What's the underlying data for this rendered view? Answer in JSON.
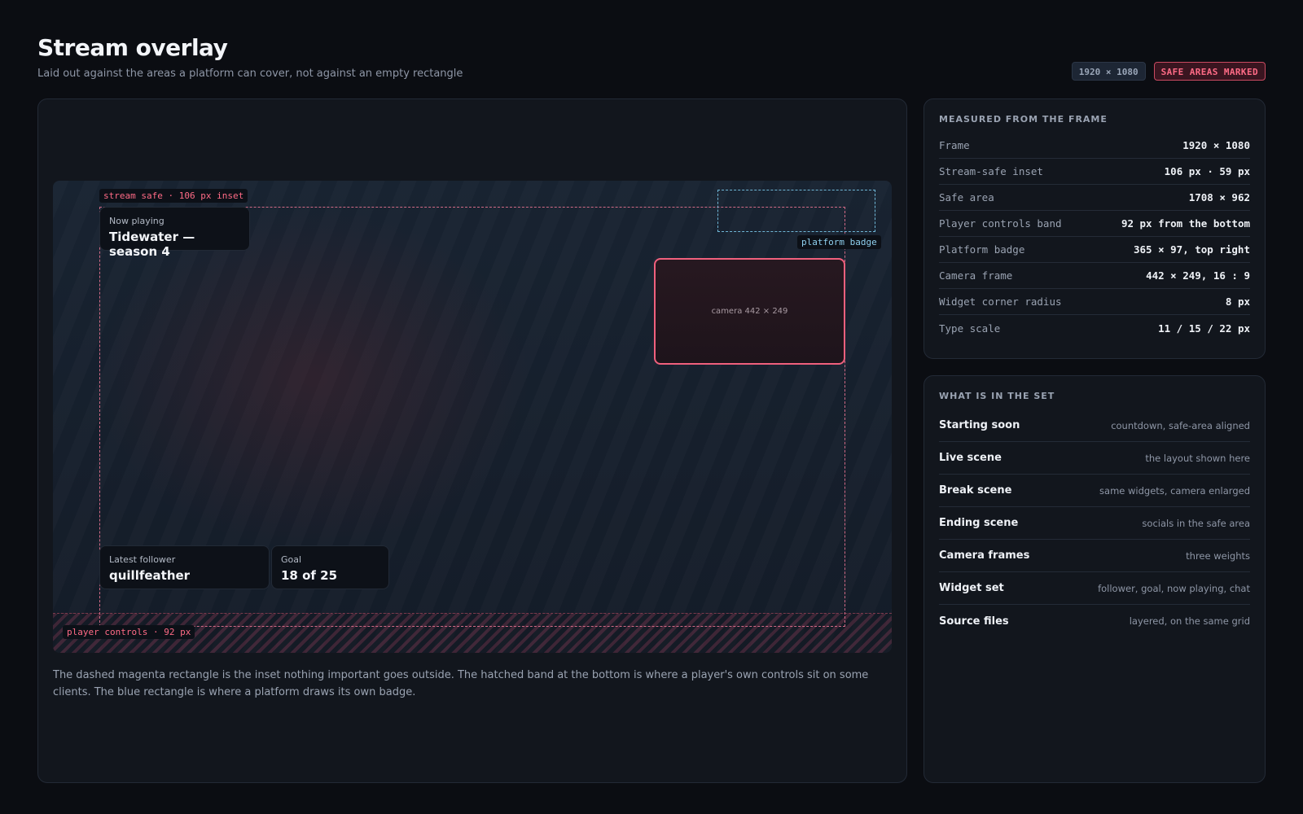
{
  "header": {
    "title": "Stream overlay",
    "subtitle": "Laid out against the areas a platform can cover, not against an empty rectangle",
    "resolution_badge": "1920 × 1080",
    "safe_badge": "SAFE AREAS MARKED"
  },
  "preview": {
    "safe_tag": "stream safe · 106 px inset",
    "badge_tag": "platform badge",
    "controls_tag": "player controls · 92 px",
    "camera_label": "camera 442 × 249",
    "widgets": {
      "now_playing": {
        "label": "Now playing",
        "value": "Tidewater — season 4"
      },
      "follower": {
        "label": "Latest follower",
        "value": "quillfeather"
      },
      "goal": {
        "label": "Goal",
        "value": "18 of 25"
      }
    },
    "caption": "The dashed magenta rectangle is the inset nothing important goes outside. The hatched band at the bottom is where a player's own controls sit on some clients. The blue rectangle is where a platform draws its own badge."
  },
  "measured": {
    "title": "MEASURED FROM THE FRAME",
    "rows": [
      {
        "key": "Frame",
        "value": "1920 × 1080"
      },
      {
        "key": "Stream-safe inset",
        "value": "106 px · 59 px"
      },
      {
        "key": "Safe area",
        "value": "1708 × 962"
      },
      {
        "key": "Player controls band",
        "value": "92 px from the bottom"
      },
      {
        "key": "Platform badge",
        "value": "365 × 97, top right"
      },
      {
        "key": "Camera frame",
        "value": "442 × 249, 16 : 9"
      },
      {
        "key": "Widget corner radius",
        "value": "8 px"
      },
      {
        "key": "Type scale",
        "value": "11 / 15 / 22 px"
      }
    ]
  },
  "set": {
    "title": "WHAT IS IN THE SET",
    "rows": [
      {
        "key": "Starting soon",
        "value": "countdown, safe-area aligned"
      },
      {
        "key": "Live scene",
        "value": "the layout shown here"
      },
      {
        "key": "Break scene",
        "value": "same widgets, camera enlarged"
      },
      {
        "key": "Ending scene",
        "value": "socials in the safe area"
      },
      {
        "key": "Camera frames",
        "value": "three weights"
      },
      {
        "key": "Widget set",
        "value": "follower, goal, now playing, chat"
      },
      {
        "key": "Source files",
        "value": "layered, on the same grid"
      }
    ]
  },
  "colors": {
    "background": "#0b0d12",
    "panel": "#12161d",
    "safe_accent": "#ff6b86",
    "badge_accent": "#6fb6d6"
  }
}
